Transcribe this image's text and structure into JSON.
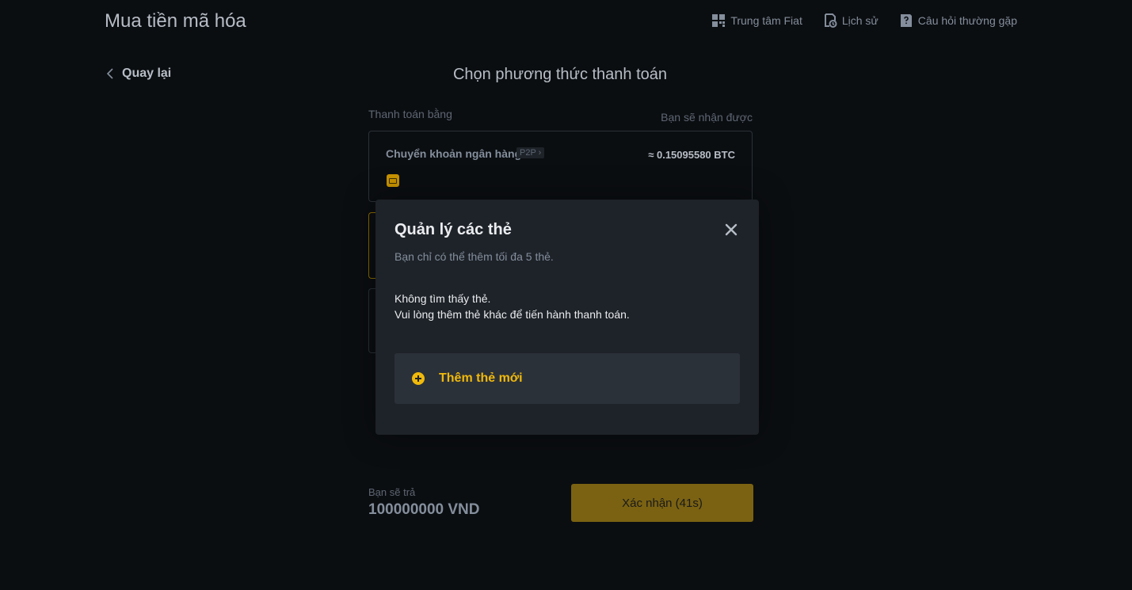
{
  "app": {
    "title": "Mua tiền mã hóa"
  },
  "topnav": {
    "items": [
      {
        "label": "Trung tâm Fiat",
        "icon": "grid-icon"
      },
      {
        "label": "Lịch sử",
        "icon": "history-icon"
      },
      {
        "label": "Câu hỏi thường gặp",
        "icon": "faq-icon"
      }
    ]
  },
  "back": {
    "label": "Quay lại"
  },
  "page": {
    "title": "Chọn phương thức thanh toán",
    "pay_with_label": "Thanh toán bằng",
    "receive_label": "Bạn sẽ nhận được"
  },
  "method": {
    "name": "Chuyển khoản ngân hàng",
    "tag": "P2P ›",
    "amount": "≈  0.15095580 BTC"
  },
  "footer": {
    "pay_label": "Bạn sẽ trả",
    "pay_amount": "100000000 VND",
    "confirm_label": "Xác nhận (41s)"
  },
  "modal": {
    "title": "Quản lý các thẻ",
    "subtitle": "Bạn chỉ có thể thêm tối đa 5 thẻ.",
    "empty_line1": "Không tìm thấy thẻ.",
    "empty_line2": "Vui lòng thêm thẻ khác để tiến hành thanh toán.",
    "add_card_label": "Thêm thẻ mới"
  },
  "colors": {
    "background": "#0b0e11",
    "modal_bg": "#1e2329",
    "accent": "#f0b90b",
    "confirm_dimmed": "#7a6212"
  }
}
